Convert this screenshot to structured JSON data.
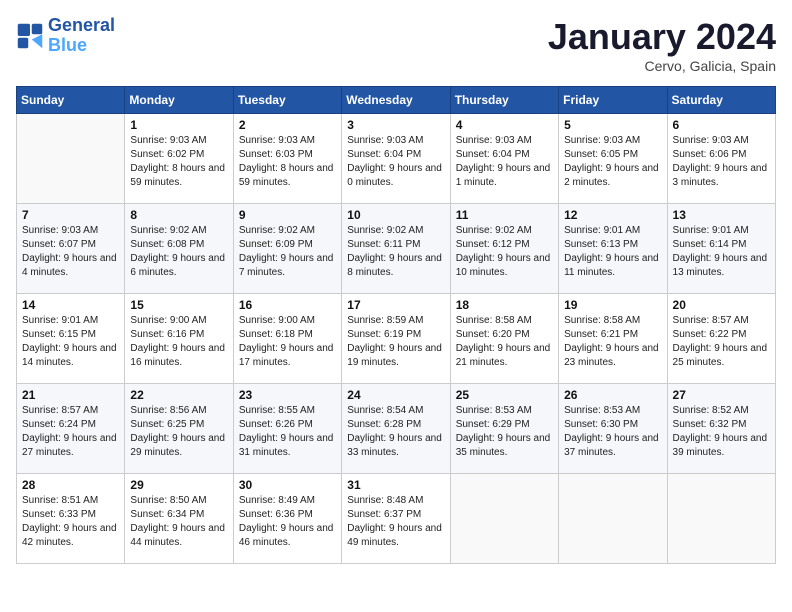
{
  "logo": {
    "text_general": "General",
    "text_blue": "Blue"
  },
  "calendar": {
    "title": "January 2024",
    "subtitle": "Cervo, Galicia, Spain"
  },
  "headers": [
    "Sunday",
    "Monday",
    "Tuesday",
    "Wednesday",
    "Thursday",
    "Friday",
    "Saturday"
  ],
  "weeks": [
    [
      {
        "day": "",
        "sunrise": "",
        "sunset": "",
        "daylight": ""
      },
      {
        "day": "1",
        "sunrise": "Sunrise: 9:03 AM",
        "sunset": "Sunset: 6:02 PM",
        "daylight": "Daylight: 8 hours and 59 minutes."
      },
      {
        "day": "2",
        "sunrise": "Sunrise: 9:03 AM",
        "sunset": "Sunset: 6:03 PM",
        "daylight": "Daylight: 8 hours and 59 minutes."
      },
      {
        "day": "3",
        "sunrise": "Sunrise: 9:03 AM",
        "sunset": "Sunset: 6:04 PM",
        "daylight": "Daylight: 9 hours and 0 minutes."
      },
      {
        "day": "4",
        "sunrise": "Sunrise: 9:03 AM",
        "sunset": "Sunset: 6:04 PM",
        "daylight": "Daylight: 9 hours and 1 minute."
      },
      {
        "day": "5",
        "sunrise": "Sunrise: 9:03 AM",
        "sunset": "Sunset: 6:05 PM",
        "daylight": "Daylight: 9 hours and 2 minutes."
      },
      {
        "day": "6",
        "sunrise": "Sunrise: 9:03 AM",
        "sunset": "Sunset: 6:06 PM",
        "daylight": "Daylight: 9 hours and 3 minutes."
      }
    ],
    [
      {
        "day": "7",
        "sunrise": "Sunrise: 9:03 AM",
        "sunset": "Sunset: 6:07 PM",
        "daylight": "Daylight: 9 hours and 4 minutes."
      },
      {
        "day": "8",
        "sunrise": "Sunrise: 9:02 AM",
        "sunset": "Sunset: 6:08 PM",
        "daylight": "Daylight: 9 hours and 6 minutes."
      },
      {
        "day": "9",
        "sunrise": "Sunrise: 9:02 AM",
        "sunset": "Sunset: 6:09 PM",
        "daylight": "Daylight: 9 hours and 7 minutes."
      },
      {
        "day": "10",
        "sunrise": "Sunrise: 9:02 AM",
        "sunset": "Sunset: 6:11 PM",
        "daylight": "Daylight: 9 hours and 8 minutes."
      },
      {
        "day": "11",
        "sunrise": "Sunrise: 9:02 AM",
        "sunset": "Sunset: 6:12 PM",
        "daylight": "Daylight: 9 hours and 10 minutes."
      },
      {
        "day": "12",
        "sunrise": "Sunrise: 9:01 AM",
        "sunset": "Sunset: 6:13 PM",
        "daylight": "Daylight: 9 hours and 11 minutes."
      },
      {
        "day": "13",
        "sunrise": "Sunrise: 9:01 AM",
        "sunset": "Sunset: 6:14 PM",
        "daylight": "Daylight: 9 hours and 13 minutes."
      }
    ],
    [
      {
        "day": "14",
        "sunrise": "Sunrise: 9:01 AM",
        "sunset": "Sunset: 6:15 PM",
        "daylight": "Daylight: 9 hours and 14 minutes."
      },
      {
        "day": "15",
        "sunrise": "Sunrise: 9:00 AM",
        "sunset": "Sunset: 6:16 PM",
        "daylight": "Daylight: 9 hours and 16 minutes."
      },
      {
        "day": "16",
        "sunrise": "Sunrise: 9:00 AM",
        "sunset": "Sunset: 6:18 PM",
        "daylight": "Daylight: 9 hours and 17 minutes."
      },
      {
        "day": "17",
        "sunrise": "Sunrise: 8:59 AM",
        "sunset": "Sunset: 6:19 PM",
        "daylight": "Daylight: 9 hours and 19 minutes."
      },
      {
        "day": "18",
        "sunrise": "Sunrise: 8:58 AM",
        "sunset": "Sunset: 6:20 PM",
        "daylight": "Daylight: 9 hours and 21 minutes."
      },
      {
        "day": "19",
        "sunrise": "Sunrise: 8:58 AM",
        "sunset": "Sunset: 6:21 PM",
        "daylight": "Daylight: 9 hours and 23 minutes."
      },
      {
        "day": "20",
        "sunrise": "Sunrise: 8:57 AM",
        "sunset": "Sunset: 6:22 PM",
        "daylight": "Daylight: 9 hours and 25 minutes."
      }
    ],
    [
      {
        "day": "21",
        "sunrise": "Sunrise: 8:57 AM",
        "sunset": "Sunset: 6:24 PM",
        "daylight": "Daylight: 9 hours and 27 minutes."
      },
      {
        "day": "22",
        "sunrise": "Sunrise: 8:56 AM",
        "sunset": "Sunset: 6:25 PM",
        "daylight": "Daylight: 9 hours and 29 minutes."
      },
      {
        "day": "23",
        "sunrise": "Sunrise: 8:55 AM",
        "sunset": "Sunset: 6:26 PM",
        "daylight": "Daylight: 9 hours and 31 minutes."
      },
      {
        "day": "24",
        "sunrise": "Sunrise: 8:54 AM",
        "sunset": "Sunset: 6:28 PM",
        "daylight": "Daylight: 9 hours and 33 minutes."
      },
      {
        "day": "25",
        "sunrise": "Sunrise: 8:53 AM",
        "sunset": "Sunset: 6:29 PM",
        "daylight": "Daylight: 9 hours and 35 minutes."
      },
      {
        "day": "26",
        "sunrise": "Sunrise: 8:53 AM",
        "sunset": "Sunset: 6:30 PM",
        "daylight": "Daylight: 9 hours and 37 minutes."
      },
      {
        "day": "27",
        "sunrise": "Sunrise: 8:52 AM",
        "sunset": "Sunset: 6:32 PM",
        "daylight": "Daylight: 9 hours and 39 minutes."
      }
    ],
    [
      {
        "day": "28",
        "sunrise": "Sunrise: 8:51 AM",
        "sunset": "Sunset: 6:33 PM",
        "daylight": "Daylight: 9 hours and 42 minutes."
      },
      {
        "day": "29",
        "sunrise": "Sunrise: 8:50 AM",
        "sunset": "Sunset: 6:34 PM",
        "daylight": "Daylight: 9 hours and 44 minutes."
      },
      {
        "day": "30",
        "sunrise": "Sunrise: 8:49 AM",
        "sunset": "Sunset: 6:36 PM",
        "daylight": "Daylight: 9 hours and 46 minutes."
      },
      {
        "day": "31",
        "sunrise": "Sunrise: 8:48 AM",
        "sunset": "Sunset: 6:37 PM",
        "daylight": "Daylight: 9 hours and 49 minutes."
      },
      {
        "day": "",
        "sunrise": "",
        "sunset": "",
        "daylight": ""
      },
      {
        "day": "",
        "sunrise": "",
        "sunset": "",
        "daylight": ""
      },
      {
        "day": "",
        "sunrise": "",
        "sunset": "",
        "daylight": ""
      }
    ]
  ]
}
